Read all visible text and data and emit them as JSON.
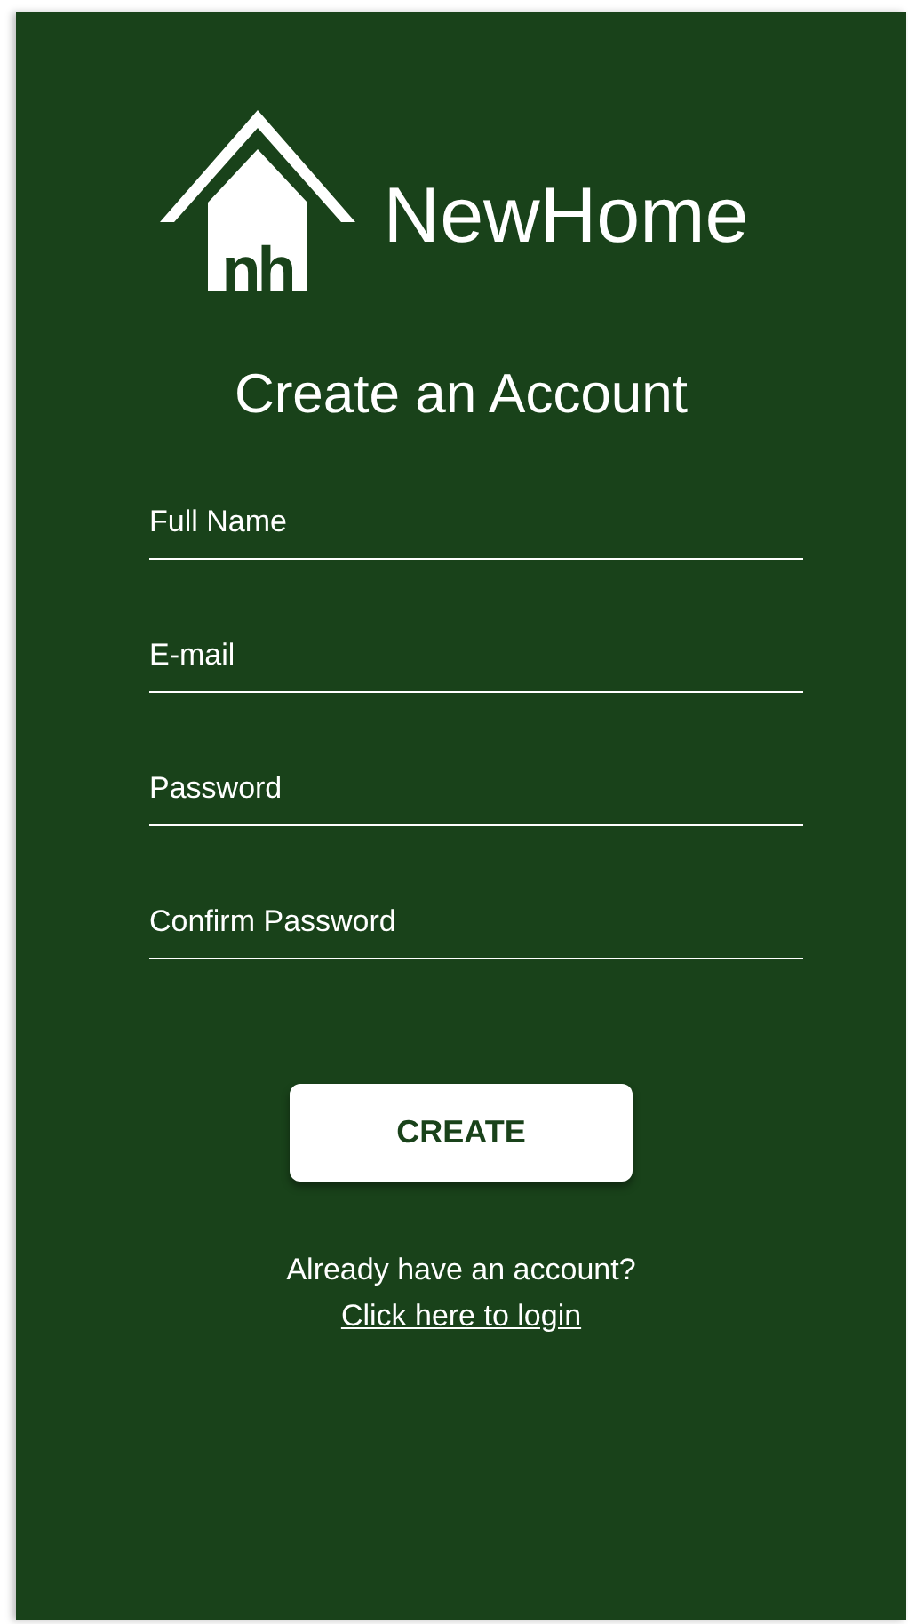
{
  "logo": {
    "mark": "nh",
    "name": "NewHome"
  },
  "title": "Create an Account",
  "fields": [
    {
      "placeholder": "Full Name"
    },
    {
      "placeholder": "E-mail"
    },
    {
      "placeholder": "Password"
    },
    {
      "placeholder": "Confirm Password"
    }
  ],
  "button": "CREATE",
  "footer": {
    "text": "Already have an account?",
    "link": "Click here to login"
  }
}
